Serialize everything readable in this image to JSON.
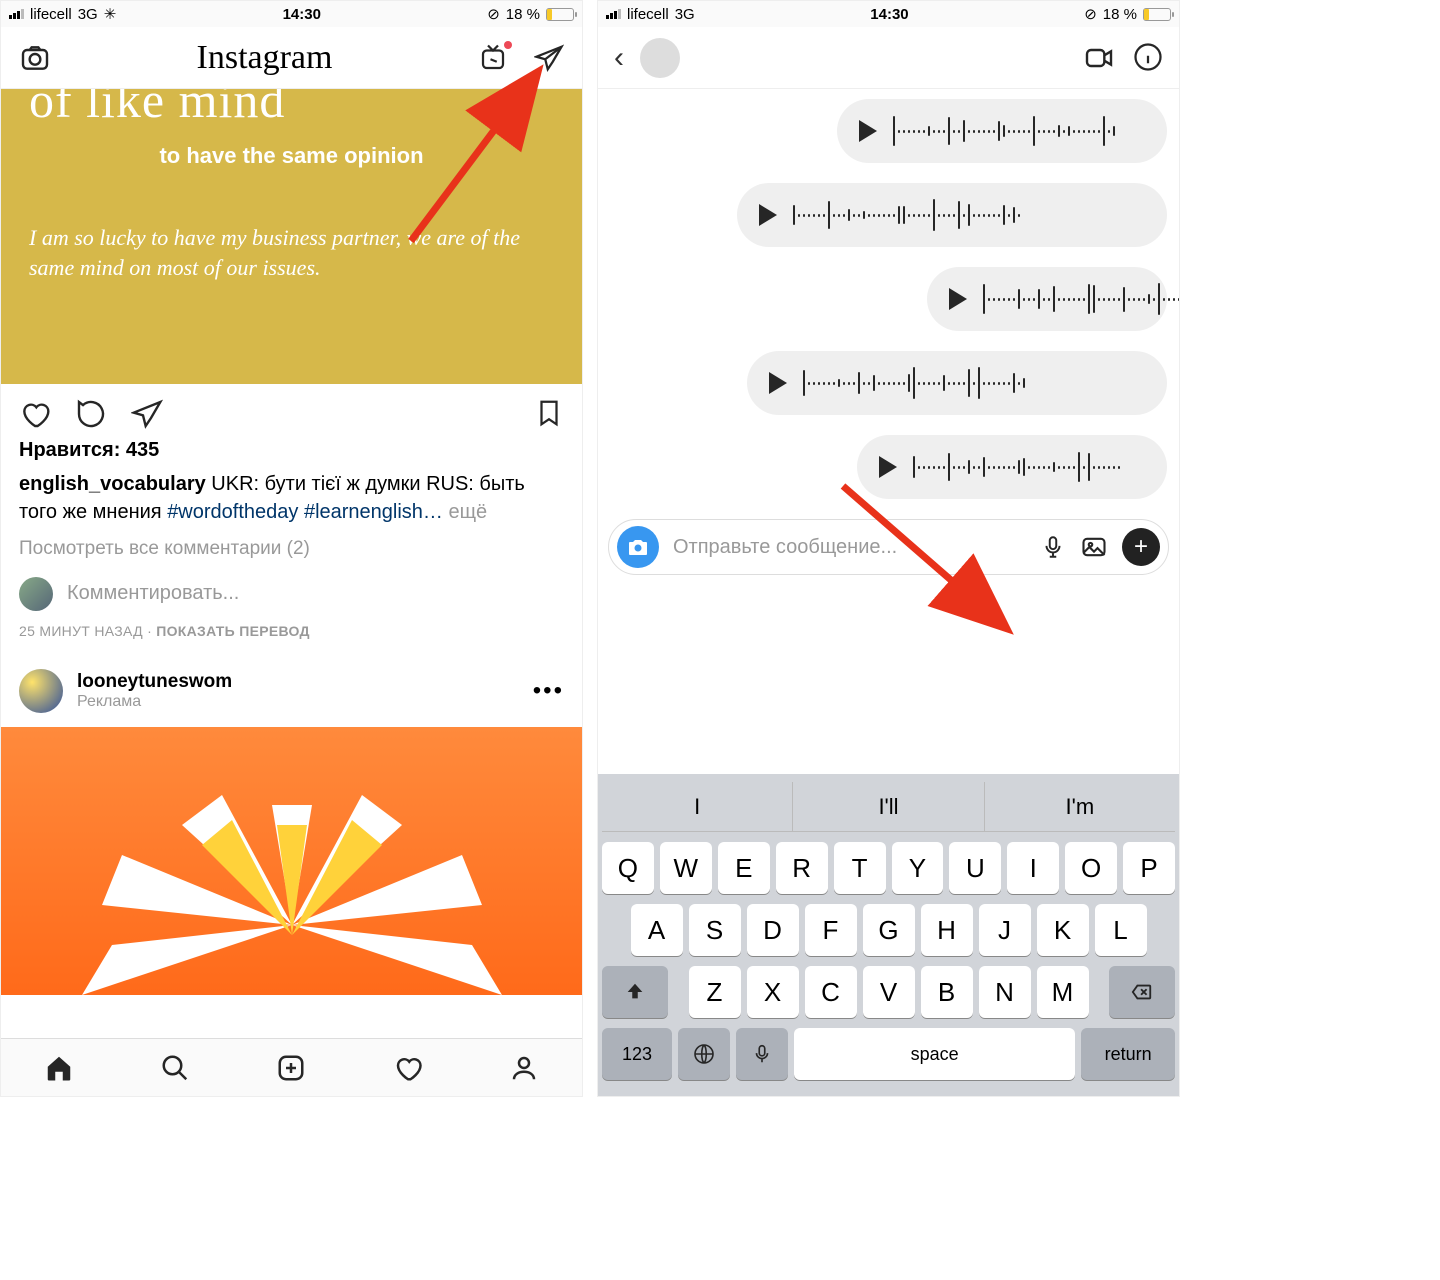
{
  "status": {
    "carrier": "lifecell",
    "network": "3G",
    "time": "14:30",
    "battery_pct": "18 %"
  },
  "left": {
    "logo": "Instagram",
    "post": {
      "title": "of like mind",
      "subtitle": "to have the same opinion",
      "example": "I am so lucky to have my business partner, we are of the same mind on most of our issues."
    },
    "likes": "Нравится: 435",
    "caption_user": "english_vocabulary",
    "caption_text": " UKR: бути тієї ж думки RUS: быть того же мнения ",
    "caption_hash": "#wordoftheday #learnenglish…",
    "caption_more": " ещё",
    "view_comments": "Посмотреть все комментарии (2)",
    "comment_placeholder": "Комментировать...",
    "time_ago": "25 МИНУТ НАЗАД",
    "translate": "ПОКАЗАТЬ ПЕРЕВОД",
    "promo_user": "looneytuneswom",
    "promo_label": "Реклама"
  },
  "right": {
    "composer_placeholder": "Отправьте сообщение...",
    "suggestions": [
      "I",
      "I'll",
      "I'm"
    ],
    "rows": [
      [
        "Q",
        "W",
        "E",
        "R",
        "T",
        "Y",
        "U",
        "I",
        "O",
        "P"
      ],
      [
        "A",
        "S",
        "D",
        "F",
        "G",
        "H",
        "J",
        "K",
        "L"
      ],
      [
        "Z",
        "X",
        "C",
        "V",
        "B",
        "N",
        "M"
      ]
    ],
    "key_123": "123",
    "key_space": "space",
    "key_return": "return"
  }
}
